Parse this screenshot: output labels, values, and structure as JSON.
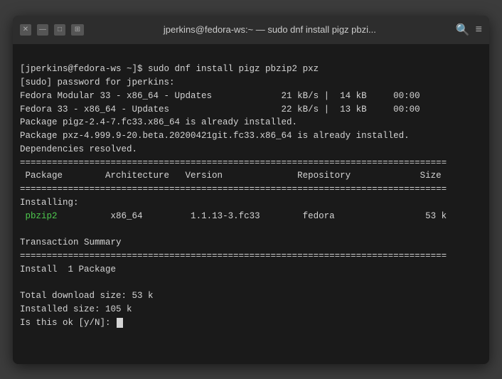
{
  "titlebar": {
    "title": "jperkins@fedora-ws:~ — sudo dnf install pigz pbzi...",
    "close_label": "✕",
    "minimize_label": "—",
    "maximize_label": "□",
    "new_tab_label": "⊞",
    "search_label": "🔍",
    "menu_label": "≡"
  },
  "terminal": {
    "lines": [
      "[jperkins@fedora-ws ~]$ sudo dnf install pigz pbzip2 pxz",
      "[sudo] password for jperkins:",
      "Fedora Modular 33 - x86_64 - Updates             21 kB/s |  14 kB     00:00",
      "Fedora 33 - x86_64 - Updates                     22 kB/s |  13 kB     00:00",
      "Package pigz-2.4-7.fc33.x86_64 is already installed.",
      "Package pxz-4.999.9-20.beta.20200421git.fc33.x86_64 is already installed.",
      "Dependencies resolved.",
      "================================================================================",
      " Package        Architecture   Version              Repository             Size",
      "================================================================================",
      "Installing:",
      "",
      "",
      "                x86_64         1.1.13-3.fc33        fedora                 53 k",
      "",
      "Transaction Summary",
      "================================================================================",
      "Install  1 Package",
      "",
      "Total download size: 53 k",
      "Installed size: 105 k",
      "Is this ok [y/N]: "
    ],
    "pbzip2_label": "pbzip2",
    "prompt_end": "Is this ok [y/N]: "
  }
}
